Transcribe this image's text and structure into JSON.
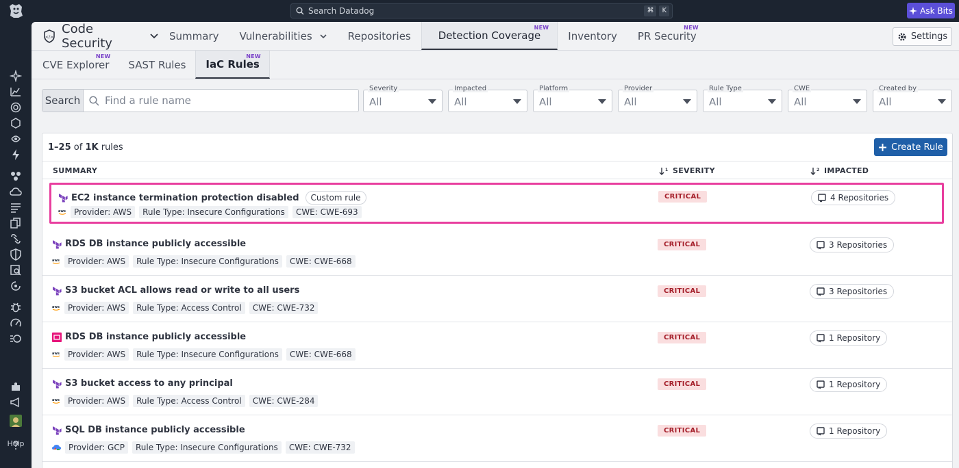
{
  "top_bar": {
    "search_placeholder": "Search Datadog",
    "shortcut_keys": [
      "⌘",
      "K"
    ],
    "ask_bits_label": "Ask Bits"
  },
  "side_nav": {
    "help_label": "Help",
    "icons": [
      "sparkle-icon",
      "dashboards-icon",
      "apm-icon",
      "infrastructure-icon",
      "logs-icon",
      "bolt-icon",
      "service-map-icon",
      "cloud-icon",
      "list-icon",
      "docs-icon",
      "link-icon",
      "security-icon",
      "search-icon",
      "watchdog-icon",
      "bug-icon",
      "speed-icon",
      "synthetics-icon",
      "integrations-icon",
      "announcements-icon",
      "user-avatar-icon"
    ]
  },
  "tabs": {
    "product_title": "Code Security",
    "items": [
      {
        "label": "Summary",
        "badge": ""
      },
      {
        "label": "Vulnerabilities",
        "badge": ""
      },
      {
        "label": "Repositories",
        "badge": ""
      },
      {
        "label": "Detection Coverage",
        "badge": "NEW"
      },
      {
        "label": "Inventory",
        "badge": ""
      },
      {
        "label": "PR Security",
        "badge": "NEW"
      }
    ],
    "settings_label": "Settings"
  },
  "subtabs": [
    {
      "label": "CVE Explorer",
      "badge": "NEW"
    },
    {
      "label": "SAST Rules",
      "badge": ""
    },
    {
      "label": "IaC Rules",
      "badge": "NEW"
    }
  ],
  "filters": {
    "search_label": "Search",
    "search_placeholder": "Find a rule name",
    "dropdowns": [
      {
        "label": "Severity",
        "value": "All"
      },
      {
        "label": "Impacted",
        "value": "All"
      },
      {
        "label": "Platform",
        "value": "All"
      },
      {
        "label": "Provider",
        "value": "All"
      },
      {
        "label": "Rule Type",
        "value": "All"
      },
      {
        "label": "CWE",
        "value": "All"
      },
      {
        "label": "Created by",
        "value": "All"
      }
    ]
  },
  "table": {
    "count_range": "1–25",
    "count_of": "of",
    "count_total": "1K",
    "count_suffix": "rules",
    "create_label": "Create Rule",
    "columns": {
      "summary": "SUMMARY",
      "severity": "SEVERITY",
      "impacted": "IMPACTED"
    },
    "rows": [
      {
        "title": "EC2 instance termination protection disabled",
        "custom": "Custom rule",
        "provider": "Provider: AWS",
        "rule_type": "Rule Type: Insecure Configurations",
        "cwe": "CWE: CWE-693",
        "severity": "CRITICAL",
        "impacted": "4 Repositories",
        "platform_icon": "terraform-icon",
        "provider_icon": "aws-icon"
      },
      {
        "title": "RDS DB instance publicly accessible",
        "custom": "",
        "provider": "Provider: AWS",
        "rule_type": "Rule Type: Insecure Configurations",
        "cwe": "CWE: CWE-668",
        "severity": "CRITICAL",
        "impacted": "3 Repositories",
        "platform_icon": "terraform-icon",
        "provider_icon": "aws-icon"
      },
      {
        "title": "S3 bucket ACL allows read or write to all users",
        "custom": "",
        "provider": "Provider: AWS",
        "rule_type": "Rule Type: Access Control",
        "cwe": "CWE: CWE-732",
        "severity": "CRITICAL",
        "impacted": "3 Repositories",
        "platform_icon": "terraform-icon",
        "provider_icon": "aws-icon"
      },
      {
        "title": "RDS DB instance publicly accessible",
        "custom": "",
        "provider": "Provider: AWS",
        "rule_type": "Rule Type: Insecure Configurations",
        "cwe": "CWE: CWE-668",
        "severity": "CRITICAL",
        "impacted": "1 Repository",
        "platform_icon": "cloudformation-icon",
        "provider_icon": "aws-icon"
      },
      {
        "title": "S3 bucket access to any principal",
        "custom": "",
        "provider": "Provider: AWS",
        "rule_type": "Rule Type: Access Control",
        "cwe": "CWE: CWE-284",
        "severity": "CRITICAL",
        "impacted": "1 Repository",
        "platform_icon": "terraform-icon",
        "provider_icon": "aws-icon"
      },
      {
        "title": "SQL DB instance publicly accessible",
        "custom": "",
        "provider": "Provider: GCP",
        "rule_type": "Rule Type: Insecure Configurations",
        "cwe": "CWE: CWE-732",
        "severity": "CRITICAL",
        "impacted": "1 Repository",
        "platform_icon": "terraform-icon",
        "provider_icon": "gcp-icon"
      }
    ]
  },
  "colors": {
    "accent_pink": "#e83e9e",
    "primary_blue": "#1f5fa8",
    "critical_bg": "#fadedf",
    "critical_text": "#a5202b",
    "new_badge": "#7a42c9",
    "terraform_purple": "#7b42bc"
  }
}
